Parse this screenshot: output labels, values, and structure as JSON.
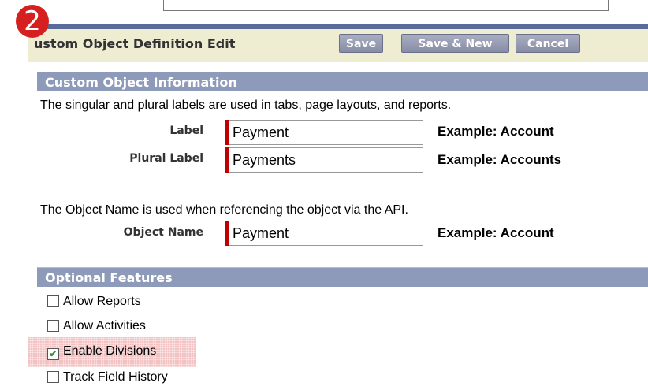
{
  "step_badge": "2",
  "header": {
    "title": "ustom Object Definition Edit",
    "buttons": {
      "save": "Save",
      "save_new": "Save & New",
      "cancel": "Cancel"
    }
  },
  "custom_info": {
    "heading": "Custom Object Information",
    "description": "The singular and plural labels are used in tabs, page layouts, and reports.",
    "fields": [
      {
        "label": "Label",
        "value": "Payment",
        "example": "Example: Account"
      },
      {
        "label": "Plural Label",
        "value": "Payments",
        "example": "Example: Accounts"
      }
    ],
    "api_description": "The Object Name is used when referencing the object via the API.",
    "object_name": {
      "label": "Object Name",
      "value": "Payment",
      "example": "Example: Account"
    }
  },
  "optional": {
    "heading": "Optional Features",
    "items": [
      {
        "label": "Allow Reports",
        "checked": false
      },
      {
        "label": "Allow Activities",
        "checked": false
      },
      {
        "label": "Enable Divisions",
        "checked": true
      },
      {
        "label": "Track Field History",
        "checked": false
      }
    ]
  },
  "colors": {
    "section_header_bg": "#8e9ab9",
    "page_header_bg": "#eeecd1",
    "button_bg": "#9da2b9",
    "required_marker": "#c00000",
    "badge": "#d6201f",
    "highlight": "#dc5050"
  }
}
